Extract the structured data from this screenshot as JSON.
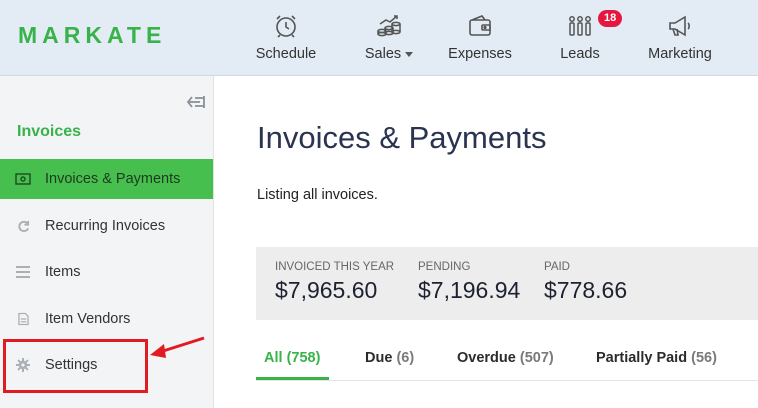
{
  "app": {
    "logo": "MARKATE",
    "brand_color": "#37b34a"
  },
  "nav": {
    "items": [
      {
        "label": "Schedule",
        "icon": "alarm-clock-icon"
      },
      {
        "label": "Sales",
        "icon": "coins-chart-icon",
        "has_dropdown": true
      },
      {
        "label": "Expenses",
        "icon": "wallet-icon"
      },
      {
        "label": "Leads",
        "icon": "people-icon",
        "badge": "18"
      },
      {
        "label": "Marketing",
        "icon": "megaphone-icon"
      }
    ]
  },
  "sidebar": {
    "section_title": "Invoices",
    "items": [
      {
        "label": "Invoices & Payments",
        "icon": "money-icon",
        "active": true
      },
      {
        "label": "Recurring Invoices",
        "icon": "refresh-icon"
      },
      {
        "label": "Items",
        "icon": "list-icon"
      },
      {
        "label": "Item Vendors",
        "icon": "document-icon"
      },
      {
        "label": "Settings",
        "icon": "gear-icon"
      }
    ]
  },
  "main": {
    "title": "Invoices & Payments",
    "subtitle": "Listing all invoices.",
    "stats": [
      {
        "label": "INVOICED THIS YEAR",
        "value": "$7,965.60"
      },
      {
        "label": "PENDING",
        "value": "$7,196.94"
      },
      {
        "label": "PAID",
        "value": "$778.66"
      }
    ],
    "tabs": [
      {
        "label": "All",
        "count": "(758)",
        "active": true
      },
      {
        "label": "Due",
        "count": "(6)"
      },
      {
        "label": "Overdue",
        "count": "(507)"
      },
      {
        "label": "Partially Paid",
        "count": "(56)"
      }
    ]
  },
  "annotation": {
    "highlight_color": "#e11b22"
  }
}
